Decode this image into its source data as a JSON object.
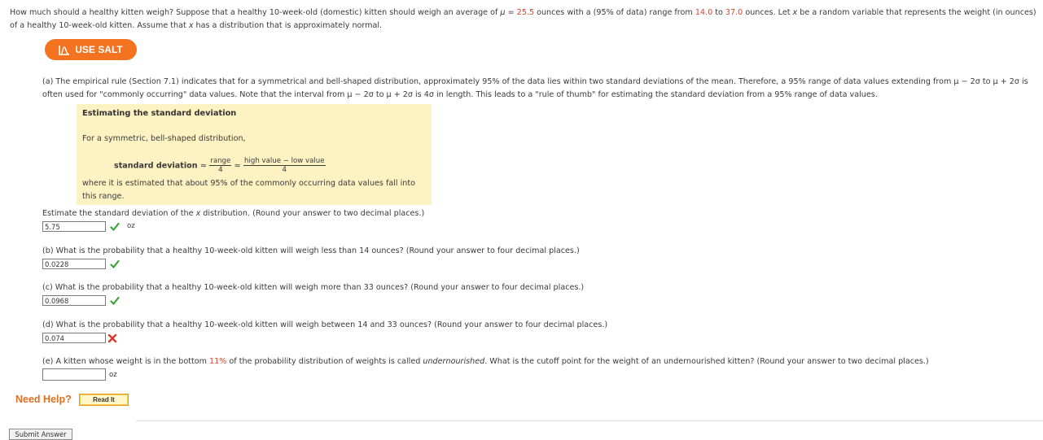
{
  "intro": {
    "t1": "How much should a healthy kitten weigh? Suppose that a healthy 10-week-old (domestic) kitten should weigh an average of ",
    "mu_sym": "μ",
    "t2": " = ",
    "mean": "25.5",
    "t3": " ounces with a (95% of data) range from ",
    "low": "14.0",
    "t4": " to ",
    "high": "37.0",
    "t5": " ounces. Let ",
    "x1": "x",
    "t6": " be a random variable that represents the weight (in ounces) of a healthy 10-week-old kitten. Assume that ",
    "x2": "x",
    "t7": " has a distribution that is approximately normal."
  },
  "salt": {
    "label": "USE SALT",
    "icon": "salt-chart-icon",
    "color": "#f37321"
  },
  "part_a": {
    "text": "(a) The empirical rule (Section 7.1) indicates that for a symmetrical and bell-shaped distribution, approximately 95% of the data lies within two standard deviations of the mean. Therefore, a 95% range of data values extending from μ − 2σ to μ + 2σ is often used for \"commonly occurring\" data values. Note that the interval from μ − 2σ to μ + 2σ is 4σ in length. This leads to a \"rule of thumb\" for estimating the standard deviation from a 95% range of data values.",
    "box": {
      "title": "Estimating the standard deviation",
      "line1": "For a symmetric, bell-shaped distribution,",
      "formula_label": "standard deviation",
      "approx": "≈",
      "frac1_num": "range",
      "frac1_den": "4",
      "frac2_num": "high value − low value",
      "frac2_den": "4",
      "line3": "where it is estimated that about 95% of the commonly occurring data values fall into this range."
    },
    "question_pre": "Estimate the standard deviation of the ",
    "question_var": "x",
    "question_post": " distribution. (Round your answer to two decimal places.)",
    "answer": "5.75",
    "unit": "oz",
    "status": "correct"
  },
  "part_b": {
    "question": "(b) What is the probability that a healthy 10-week-old kitten will weigh less than 14 ounces? (Round your answer to four decimal places.)",
    "answer": "0.0228",
    "status": "correct"
  },
  "part_c": {
    "question": "(c) What is the probability that a healthy 10-week-old kitten will weigh more than 33 ounces? (Round your answer to four decimal places.)",
    "answer": "0.0968",
    "status": "correct"
  },
  "part_d": {
    "question": "(d) What is the probability that a healthy 10-week-old kitten will weigh between 14 and 33 ounces? (Round your answer to four decimal places.)",
    "answer": "0.074",
    "status": "incorrect"
  },
  "part_e": {
    "t1": "(e) A kitten whose weight is in the bottom ",
    "pct": "11%",
    "t2": " of the probability distribution of weights is called ",
    "term": "undernourished",
    "t3": ". What is the cutoff point for the weight of an undernourished kitten? (Round your answer to two decimal places.)",
    "answer": "",
    "unit": "oz"
  },
  "help": {
    "label": "Need Help?",
    "read_it": "Read It"
  },
  "submit_label": "Submit Answer",
  "colors": {
    "correct": "#3aa335",
    "incorrect": "#d93a2b",
    "highlight": "#d9442a",
    "accent": "#f37321"
  }
}
